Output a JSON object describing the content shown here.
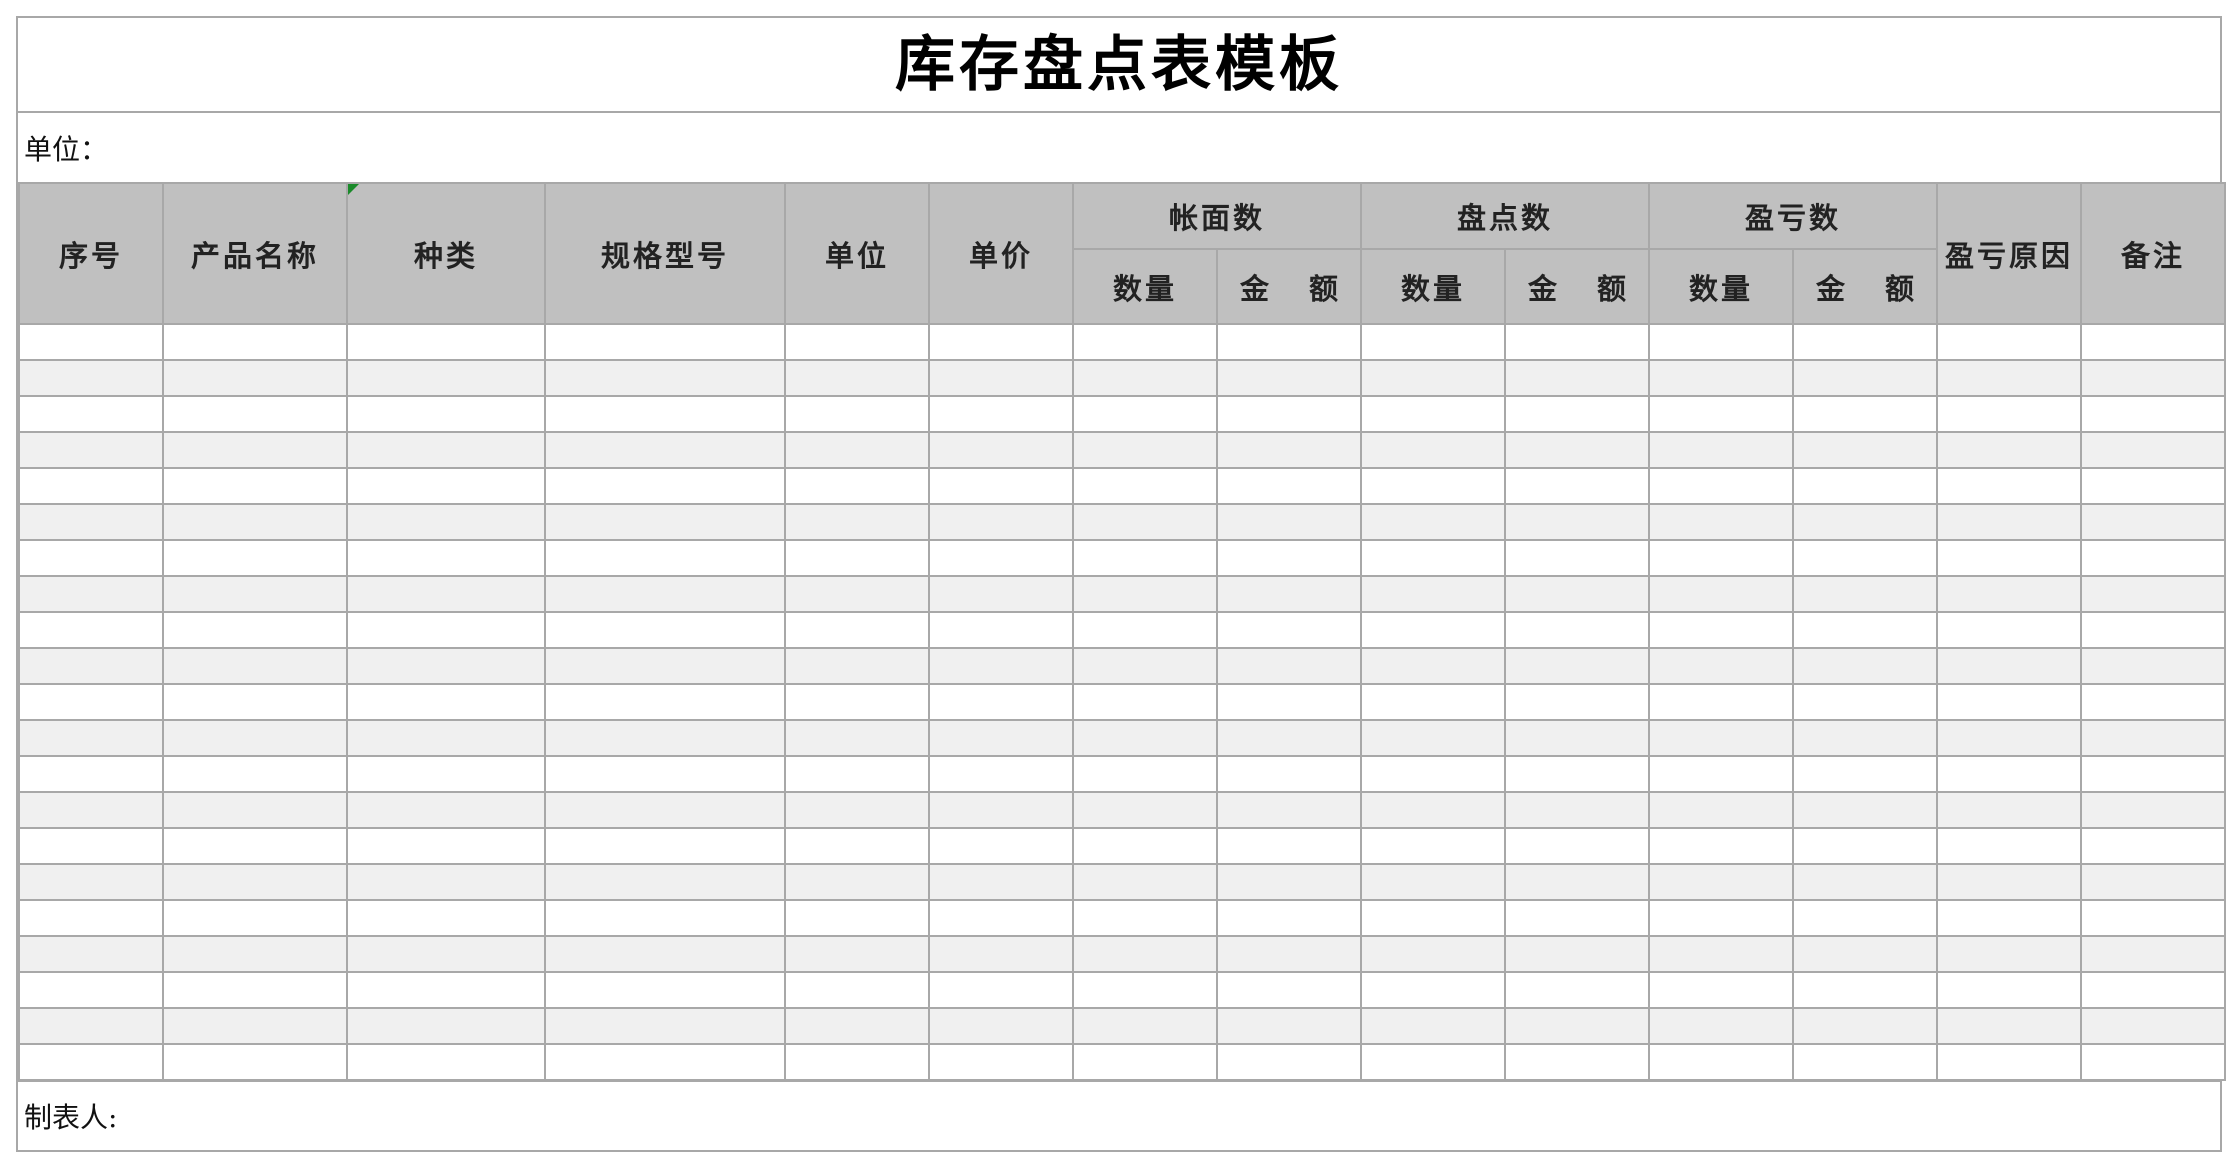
{
  "document": {
    "title": "库存盘点表模板",
    "unit_label": "单位：",
    "maker_label": "制表人:"
  },
  "table": {
    "columns": {
      "seq": "序号",
      "product_name": "产品名称",
      "category": "种类",
      "spec_model": "规格型号",
      "unit": "单位",
      "unit_price": "单价",
      "book_group": "帐面数",
      "count_group": "盘点数",
      "diff_group": "盈亏数",
      "diff_reason": "盈亏原因",
      "remarks": "备注"
    },
    "subcolumns": {
      "quantity": "数量",
      "amount_left": "金",
      "amount_right": "额"
    },
    "empty_row_count": 21
  }
}
